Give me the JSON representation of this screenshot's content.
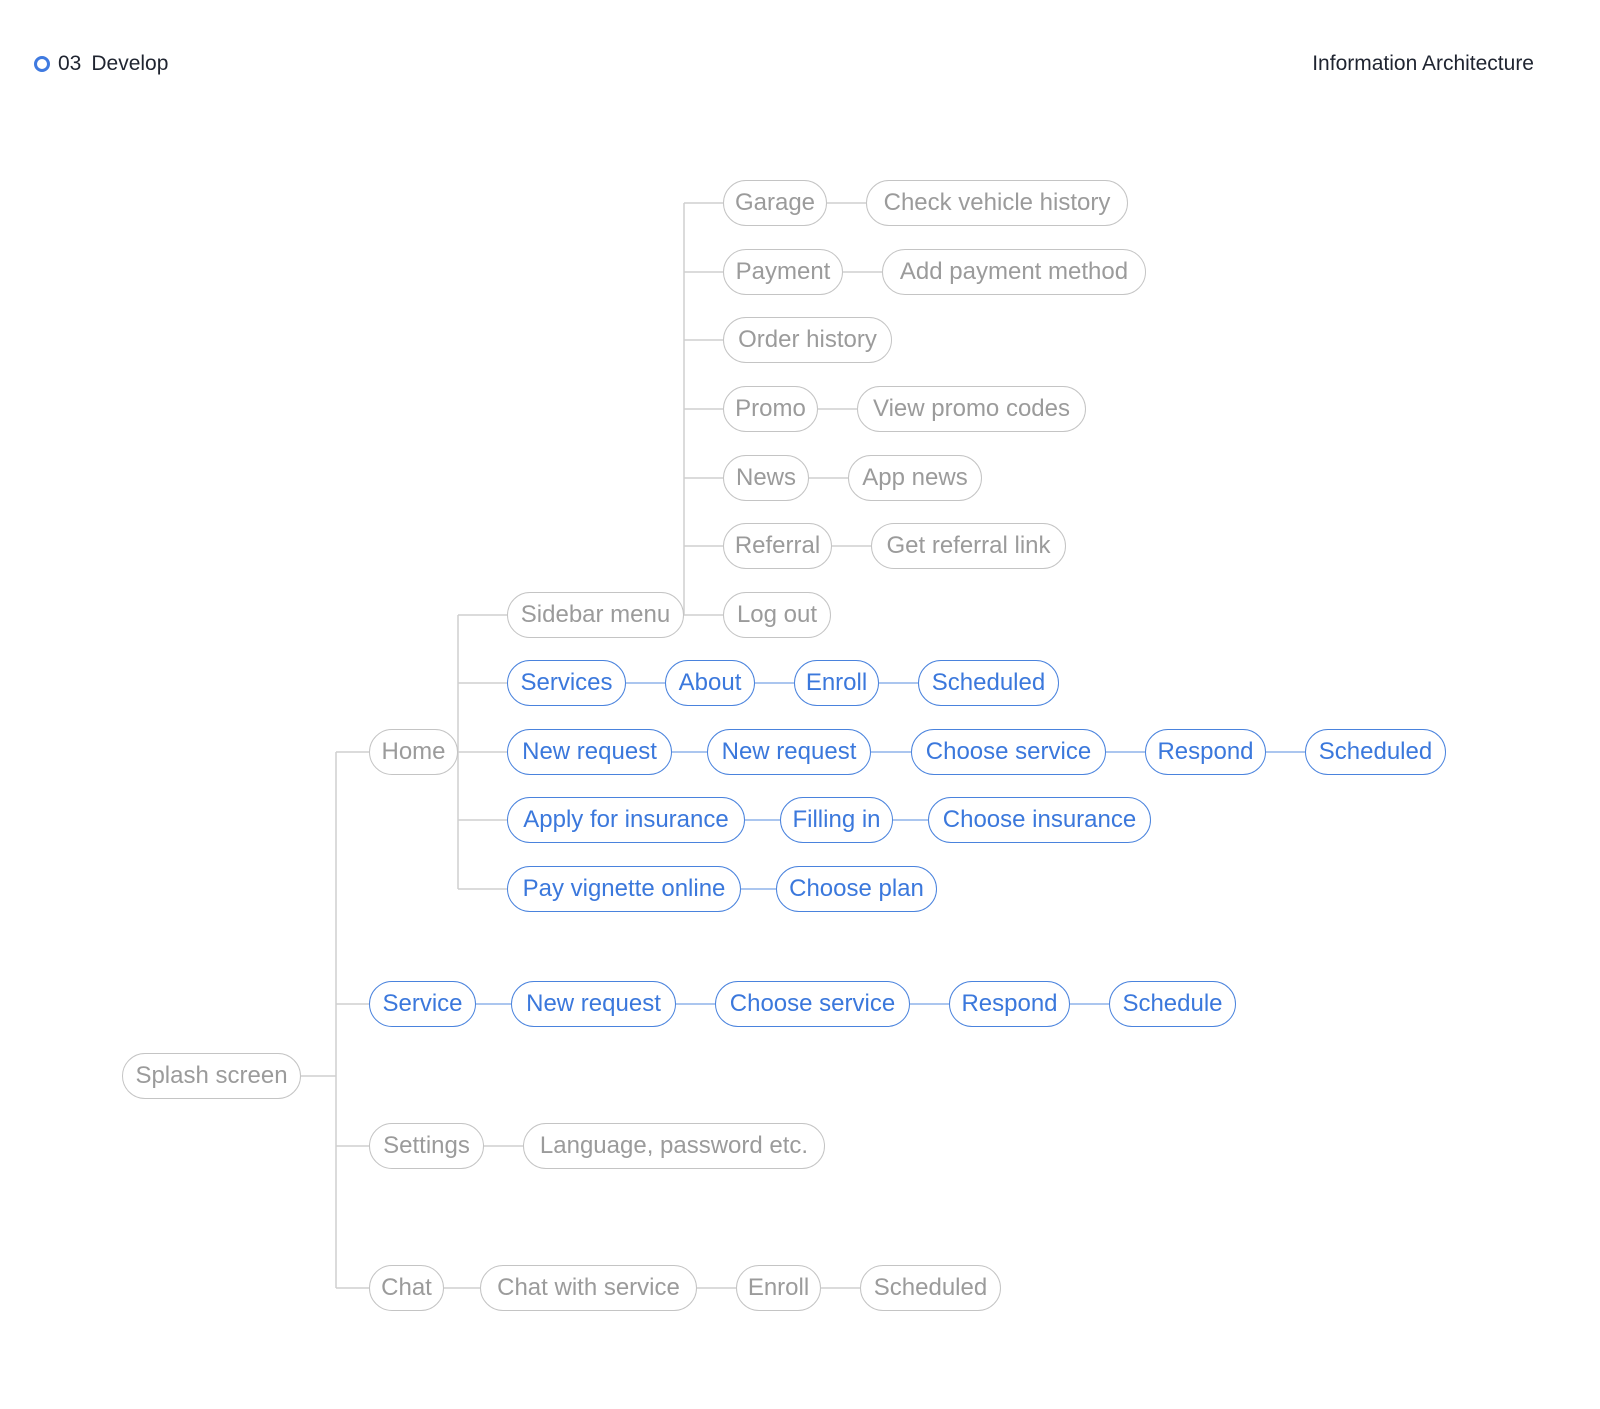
{
  "header": {
    "step_number": "03",
    "step_label": "Develop",
    "section_title": "Information Architecture"
  },
  "colors": {
    "accent": "#3b78dc",
    "inactive_text": "#9b9b9b",
    "inactive_border": "#c4c4c4",
    "connector": "#cfcfcf"
  },
  "nodes": {
    "splash": "Splash screen",
    "home": "Home",
    "sidebar_menu": "Sidebar menu",
    "garage": "Garage",
    "check_vehicle_history": "Check vehicle history",
    "payment": "Payment",
    "add_payment_method": "Add payment method",
    "order_history": "Order history",
    "promo": "Promo",
    "view_promo_codes": "View promo codes",
    "news": "News",
    "app_news": "App news",
    "referral": "Referral",
    "get_referral_link": "Get referral link",
    "log_out": "Log out",
    "services": "Services",
    "about": "About",
    "enroll_a": "Enroll",
    "scheduled_a": "Scheduled",
    "new_request_1": "New request",
    "new_request_2": "New request",
    "choose_service_a": "Choose service",
    "respond_a": "Respond",
    "scheduled_b": "Scheduled",
    "apply_insurance": "Apply for insurance",
    "filling_in": "Filling in",
    "choose_insurance": "Choose insurance",
    "pay_vignette": "Pay vignette online",
    "choose_plan": "Choose plan",
    "service": "Service",
    "new_request_3": "New request",
    "choose_service_b": "Choose service",
    "respond_b": "Respond",
    "schedule": "Schedule",
    "settings": "Settings",
    "language_password": "Language, password etc.",
    "chat": "Chat",
    "chat_with_service": "Chat with service",
    "enroll_b": "Enroll",
    "scheduled_c": "Scheduled"
  }
}
